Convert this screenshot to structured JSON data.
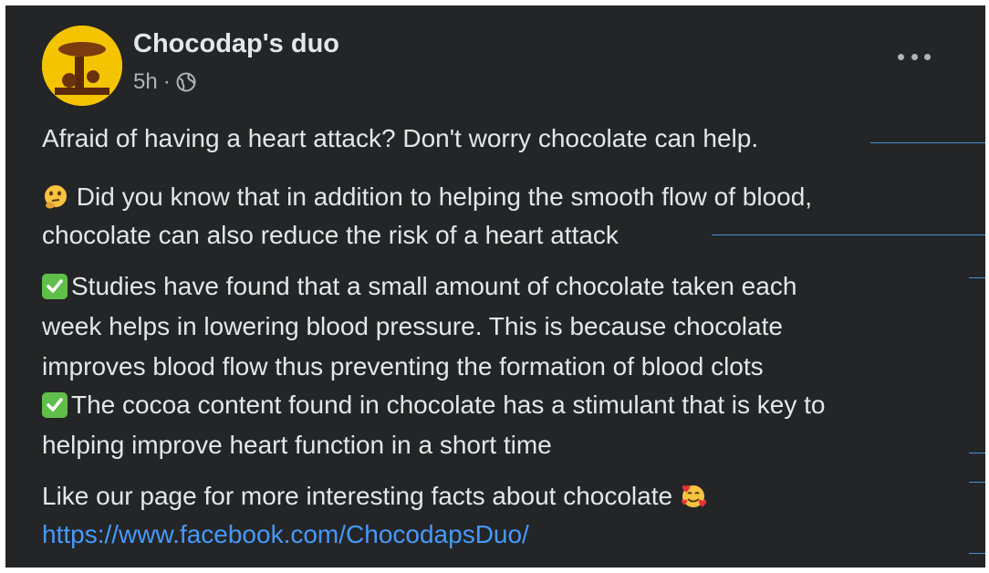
{
  "post": {
    "author": "Chocodap's duo",
    "time": "5h",
    "separator": "·",
    "paragraphs": {
      "p1": "Afraid of having a heart attack? Don't worry chocolate can help.",
      "p2a": "Did you know that in addition to helping the smooth flow of blood,",
      "p2b": "chocolate can also reduce the risk of a heart attack",
      "p3a": "Studies have found that a small amount of chocolate taken each",
      "p3b": "week helps in lowering blood pressure. This is because chocolate",
      "p3c": "improves blood flow thus preventing the formation of blood clots",
      "p4a": "The cocoa content found in chocolate has a stimulant that is key to",
      "p4b": "helping improve heart function in a short time",
      "p5": "Like our page for more interesting facts about chocolate",
      "link": "https://www.facebook.com/ChocodapsDuo/"
    },
    "icons": {
      "privacy": "globe-icon",
      "more": "more-options-icon",
      "thinking": "thinking-face-emoji",
      "check": "check-mark-emoji",
      "hearts": "smiling-face-with-hearts-emoji"
    }
  },
  "colors": {
    "background": "#242526",
    "text": "#e4e6eb",
    "secondary": "#b0b3b8",
    "link": "#4599ff",
    "annotation": "#4a90d9"
  }
}
